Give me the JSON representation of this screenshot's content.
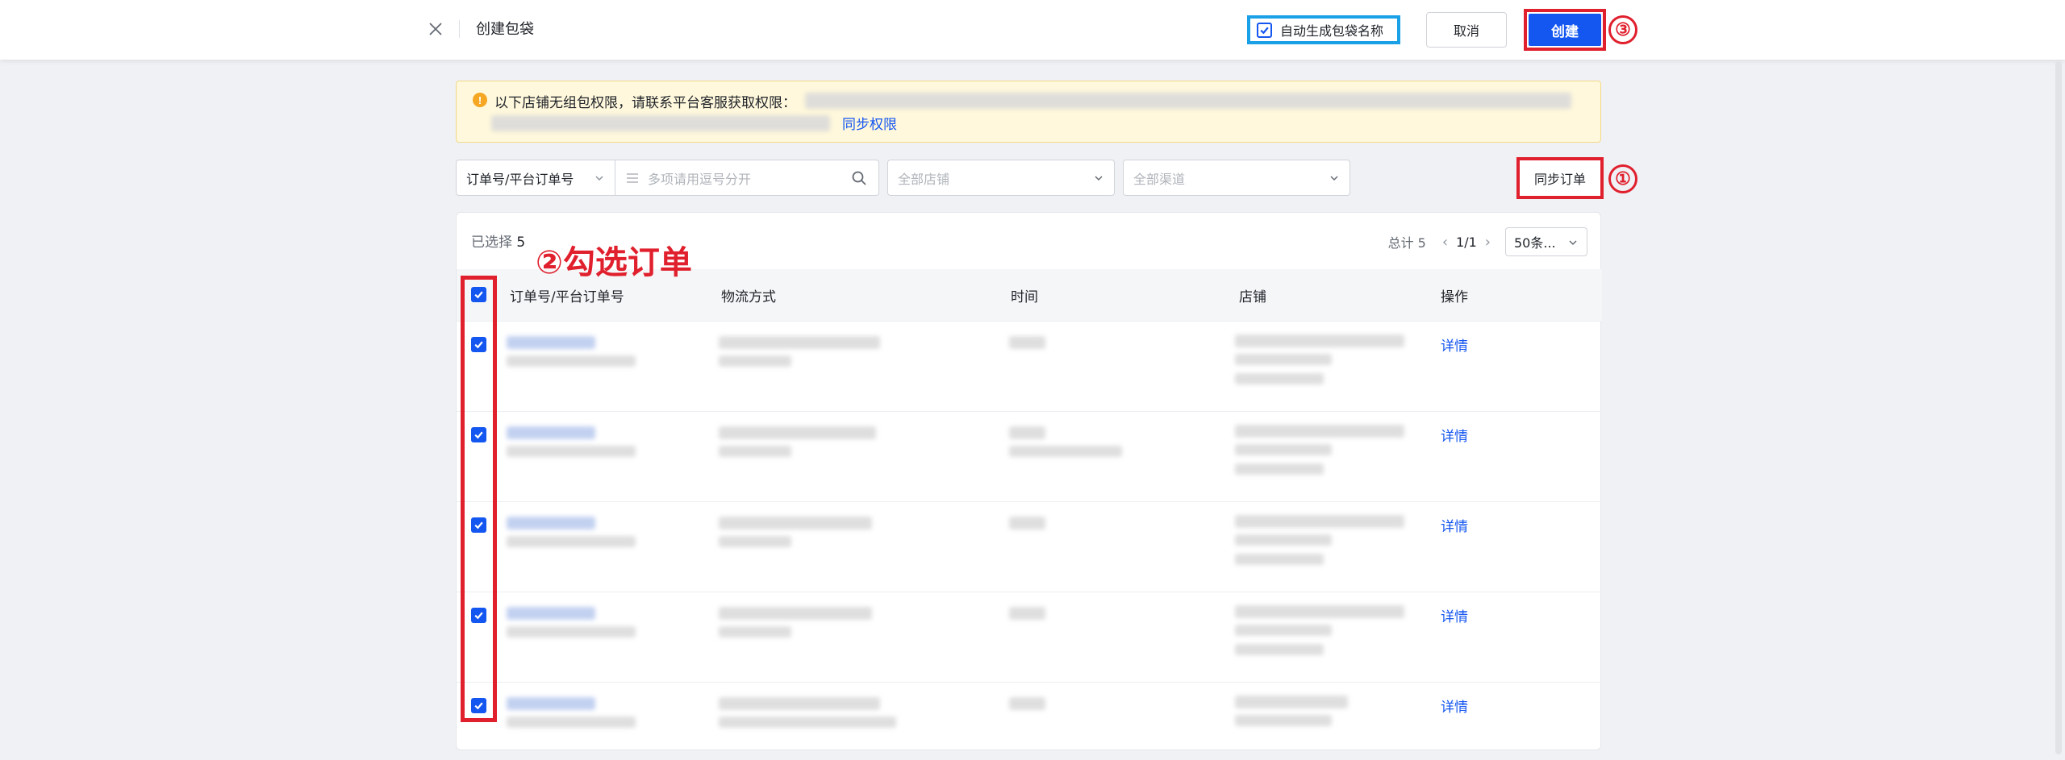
{
  "header": {
    "title": "创建包袋",
    "auto_name_label": "自动生成包袋名称",
    "auto_name_checked": true,
    "cancel_label": "取消",
    "create_label": "创建"
  },
  "warning": {
    "text": "以下店铺无组包权限，请联系平台客服获取权限：",
    "sync_permission_link": "同步权限"
  },
  "filters": {
    "order_type_select": "订单号/平台订单号",
    "search_placeholder": "多项请用逗号分开",
    "shop_placeholder": "全部店铺",
    "channel_placeholder": "全部渠道",
    "sync_orders_label": "同步订单"
  },
  "table": {
    "selected_label": "已选择",
    "selected_count": "5",
    "total_text": "总计 5",
    "page_text": "1/1",
    "page_size": "50条...",
    "columns": [
      "订单号/平台订单号",
      "物流方式",
      "时间",
      "店铺",
      "操作"
    ],
    "row_action": "详情",
    "rows": [
      {
        "checked": true,
        "action": "详情"
      },
      {
        "checked": true,
        "action": "详情"
      },
      {
        "checked": true,
        "action": "详情"
      },
      {
        "checked": true,
        "action": "详情"
      },
      {
        "checked": true,
        "action": "详情"
      }
    ]
  },
  "annotations": {
    "step1": "①",
    "step2_text": "②勾选订单",
    "step3": "③"
  },
  "colors": {
    "primary": "#1456f0",
    "annotation_red": "#e0202d",
    "highlight_blue": "#1aa0e6",
    "warning_bg": "#fff8dc"
  }
}
